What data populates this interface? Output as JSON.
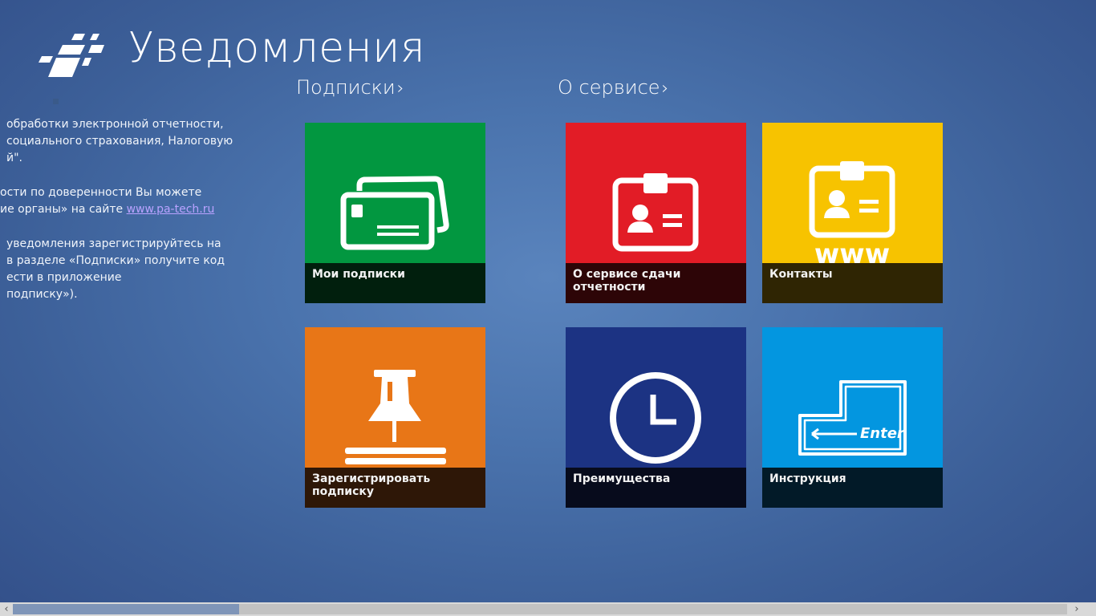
{
  "app": {
    "title": "Уведомления"
  },
  "intro": {
    "lines1": [
      "обработки электронной отчетности,",
      "социального страхования, Налоговую",
      "й\"."
    ],
    "lines2a": "ости по доверенности Вы можете",
    "lines2b": "ие органы» на сайте ",
    "link": "www.pa-tech.ru",
    "lines3": [
      "уведомления зарегистрируйтесь на",
      "в разделе «Подписки» получите код",
      "ести в приложение",
      "подписку»)."
    ]
  },
  "sections": {
    "subscriptions": "Подписки",
    "about": "О сервисе",
    "chevron": "›"
  },
  "tiles": [
    {
      "label": "Мои подписки",
      "color": "#029740",
      "bar": "#011f0d",
      "icon": "envelopes-icon"
    },
    {
      "label": "О сервисе сдачи отчетности",
      "color": "#e21c26",
      "bar": "#2d0507",
      "icon": "id-badge-icon"
    },
    {
      "label": "Контакты",
      "color": "#f7c300",
      "bar": "#2f2503",
      "icon": "contact-card-www-icon"
    },
    {
      "label": "Зарегистрировать подписку",
      "color": "#e87617",
      "bar": "#2e1707",
      "icon": "pushpin-icon"
    },
    {
      "label": "Преимущества",
      "color": "#1c3383",
      "bar": "#070b1c",
      "icon": "clock-icon"
    },
    {
      "label": "Инструкция",
      "color": "#0396e0",
      "bar": "#021a28",
      "icon": "enter-key-icon"
    }
  ],
  "icons": {
    "www_text": "www",
    "enter_text": "Enter"
  },
  "scrollbar": {
    "left": "‹",
    "right": "›"
  }
}
